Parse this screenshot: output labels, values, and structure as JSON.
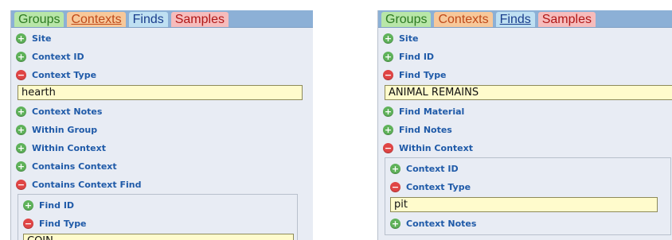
{
  "tabs": {
    "groups": "Groups",
    "contexts": "Contexts",
    "finds": "Finds",
    "samples": "Samples"
  },
  "left": {
    "site": "Site",
    "context_id": "Context ID",
    "context_type": "Context Type",
    "context_type_value": "hearth",
    "context_notes": "Context Notes",
    "within_group": "Within Group",
    "within_context": "Within Context",
    "contains_context": "Contains Context",
    "contains_context_find": "Contains Context Find",
    "sub": {
      "find_id": "Find ID",
      "find_type": "Find Type",
      "find_type_value": "COIN"
    }
  },
  "right": {
    "site": "Site",
    "find_id": "Find ID",
    "find_type": "Find Type",
    "find_type_value": "ANIMAL REMAINS",
    "find_material": "Find Material",
    "find_notes": "Find Notes",
    "within_context": "Within Context",
    "sub": {
      "context_id": "Context ID",
      "context_type": "Context Type",
      "context_type_value": "pit",
      "context_notes": "Context Notes"
    }
  },
  "icons": {
    "add": "plus-circle-icon",
    "remove": "minus-circle-icon"
  },
  "colors": {
    "label_blue": "#1f5aa8",
    "tabbar": "#8cb0d6",
    "value_bg": "#fffbcc"
  }
}
